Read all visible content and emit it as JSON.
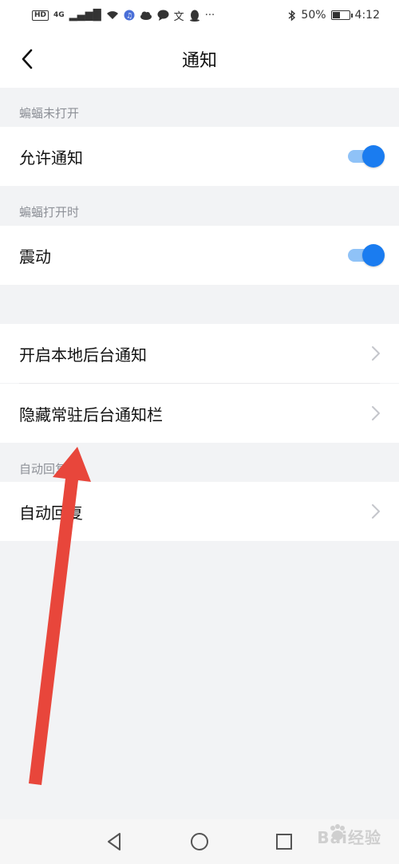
{
  "status_bar": {
    "hd_badge": "HD",
    "network": "4G",
    "bluetooth_icon": "bluetooth-icon",
    "battery_percent": "50%",
    "battery_level": 0.5,
    "time": "4:12",
    "notification_icons": [
      "wifi-icon",
      "music-icon",
      "cloud-icon",
      "chat-icon",
      "text-icon",
      "qq-icon",
      "more-icon"
    ]
  },
  "header": {
    "back_icon": "back-arrow-icon",
    "title": "通知"
  },
  "sections": {
    "when_closed_label": "蝙蝠未打开",
    "when_open_label": "蝙蝠打开时",
    "auto_reply_label": "自动回复"
  },
  "rows": {
    "allow_notifications": {
      "label": "允许通知",
      "enabled": true
    },
    "vibrate": {
      "label": "震动",
      "enabled": true
    },
    "local_background": {
      "label": "开启本地后台通知"
    },
    "hide_persistent": {
      "label": "隐藏常驻后台通知栏"
    },
    "auto_reply": {
      "label": "自动回复"
    }
  },
  "nav_bar": {
    "back": "nav-back-icon",
    "home": "nav-home-icon",
    "recents": "nav-recents-icon"
  },
  "watermark": "Bai经验",
  "colors": {
    "accent": "#1a7cf0",
    "accent_track": "#8fc2f7",
    "background": "#f2f3f5",
    "annotation_arrow": "#e8463b"
  }
}
